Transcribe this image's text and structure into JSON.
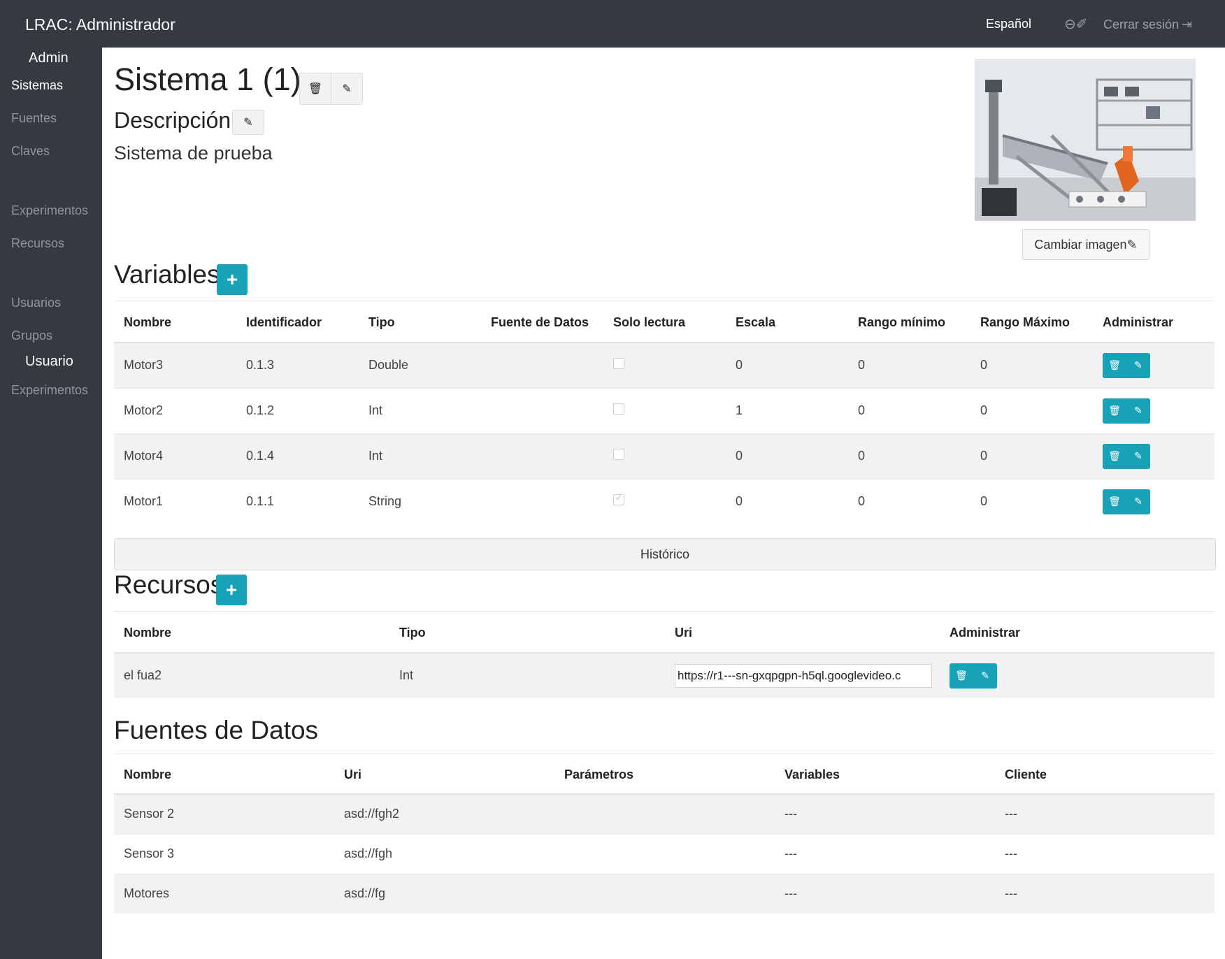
{
  "topbar": {
    "brand": "LRAC: Administrador",
    "language": "Español",
    "account_icons": "⊖✐",
    "logout_label": "Cerrar sesión",
    "logout_icon": "⇥"
  },
  "sidebar": {
    "admin_header": "Admin",
    "admin_items": [
      "Sistemas",
      "Fuentes",
      "Claves",
      "Experimentos",
      "Recursos",
      "Usuarios",
      "Grupos"
    ],
    "user_header": "Usuario",
    "user_items": [
      "Experimentos"
    ]
  },
  "system": {
    "title": "Sistema 1 (1)",
    "description_label": "Descripción",
    "description": "Sistema de prueba",
    "change_image_label": "Cambiar imagen",
    "delete_icon": "🗑",
    "edit_icon": "✎"
  },
  "variables": {
    "title": "Variables",
    "add_icon": "+",
    "headers": [
      "Nombre",
      "Identificador",
      "Tipo",
      "Fuente de Datos",
      "Solo lectura",
      "Escala",
      "Rango mínimo",
      "Rango Máximo",
      "Administrar"
    ],
    "rows": [
      {
        "nombre": "Motor3",
        "identificador": "0.1.3",
        "tipo": "Double",
        "fuente": "",
        "solo_lectura": false,
        "escala": "0",
        "rango_min": "0",
        "rango_max": "0"
      },
      {
        "nombre": "Motor2",
        "identificador": "0.1.2",
        "tipo": "Int",
        "fuente": "",
        "solo_lectura": false,
        "escala": "1",
        "rango_min": "0",
        "rango_max": "0"
      },
      {
        "nombre": "Motor4",
        "identificador": "0.1.4",
        "tipo": "Int",
        "fuente": "",
        "solo_lectura": false,
        "escala": "0",
        "rango_min": "0",
        "rango_max": "0"
      },
      {
        "nombre": "Motor1",
        "identificador": "0.1.1",
        "tipo": "String",
        "fuente": "",
        "solo_lectura": true,
        "escala": "0",
        "rango_min": "0",
        "rango_max": "0"
      }
    ],
    "history_label": "Histórico"
  },
  "recursos": {
    "title": "Recursos",
    "add_icon": "+",
    "headers": [
      "Nombre",
      "Tipo",
      "Uri",
      "Administrar"
    ],
    "rows": [
      {
        "nombre": "el fua2",
        "tipo": "Int",
        "uri": "https://r1---sn-gxqpgpn-h5ql.googlevideo.c"
      }
    ]
  },
  "fuentes": {
    "title": "Fuentes de Datos",
    "headers": [
      "Nombre",
      "Uri",
      "Parámetros",
      "Variables",
      "Cliente"
    ],
    "rows": [
      {
        "nombre": "Sensor 2",
        "uri": "asd://fgh2",
        "parametros": "",
        "variables": "---",
        "cliente": "---"
      },
      {
        "nombre": "Sensor 3",
        "uri": "asd://fgh",
        "parametros": "",
        "variables": "---",
        "cliente": "---"
      },
      {
        "nombre": "Motores",
        "uri": "asd://fg",
        "parametros": "",
        "variables": "---",
        "cliente": "---"
      }
    ]
  },
  "colors": {
    "navbar": "#343a40",
    "accent": "#17a2b8",
    "striped_row": "#f2f2f2"
  }
}
